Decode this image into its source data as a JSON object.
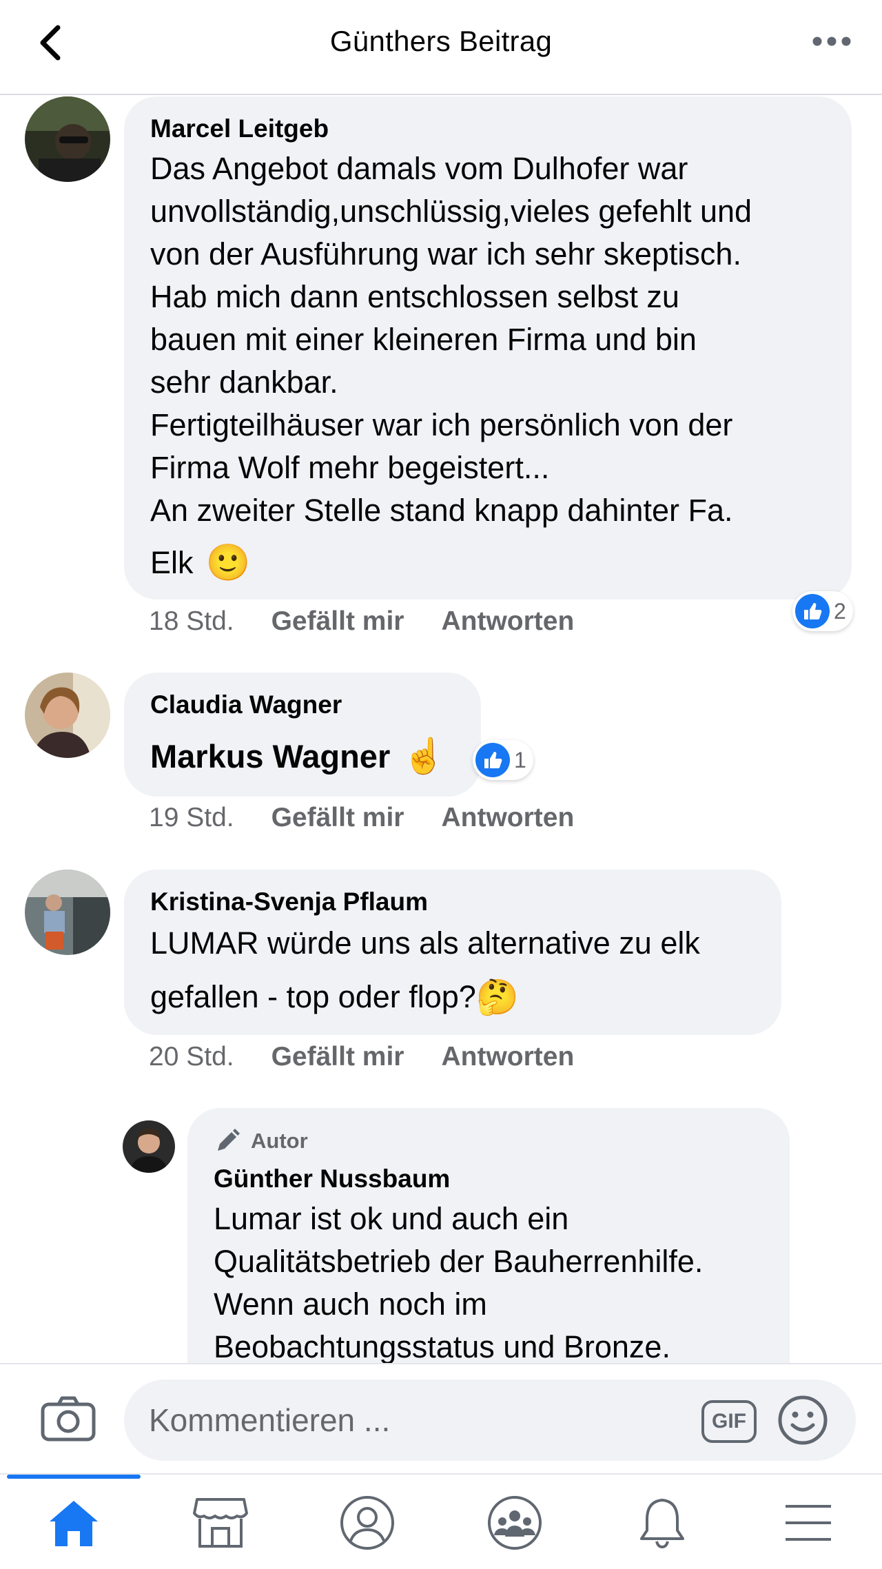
{
  "header": {
    "title": "Günthers Beitrag",
    "back_icon": "chevron-left-icon",
    "more_icon": "ellipsis-icon"
  },
  "comments": [
    {
      "author": "Marcel Leitgeb",
      "text": "Das Angebot damals vom Dulhofer war\nunvollständig,unschlüssig,vieles gefehlt und\nvon der Ausführung war ich sehr skeptisch.\nHab mich dann entschlossen selbst zu\nbauen mit einer kleineren Firma und bin\nsehr dankbar.\nFertigteilhäuser war ich persönlich von der\nFirma Wolf mehr begeistert...\nAn zweiter Stelle stand knapp dahinter Fa.",
      "last_line": "Elk",
      "emoji": "🙂",
      "time": "18 Std.",
      "like_label": "Gefällt mir",
      "reply_label": "Antworten",
      "reaction_count": "2"
    },
    {
      "author": "Claudia Wagner",
      "text": "Markus Wagner",
      "emoji": "☝️",
      "time": "19 Std.",
      "like_label": "Gefällt mir",
      "reply_label": "Antworten",
      "reaction_count": "1"
    },
    {
      "author": "Kristina-Svenja Pflaum",
      "text": "LUMAR würde uns als alternative zu elk",
      "last_line": "gefallen - top oder flop?",
      "emoji": "🤔",
      "time": "20 Std.",
      "like_label": "Gefällt mir",
      "reply_label": "Antworten"
    }
  ],
  "reply": {
    "badge": "Autor",
    "author": "Günther Nussbaum",
    "text": "Lumar ist ok und auch ein\nQualitätsbetrieb der Bauherrenhilfe.\nWenn auch noch im\nBeobachtungsstatus und Bronze."
  },
  "composer": {
    "placeholder": "Kommentieren ...",
    "gif_label": "GIF",
    "camera_icon": "camera-icon",
    "emoji_icon": "smiley-icon"
  },
  "tabs": [
    {
      "icon": "home-icon",
      "active": true
    },
    {
      "icon": "marketplace-icon",
      "active": false
    },
    {
      "icon": "profile-icon",
      "active": false
    },
    {
      "icon": "groups-icon",
      "active": false
    },
    {
      "icon": "bell-icon",
      "active": false
    },
    {
      "icon": "menu-icon",
      "active": false
    }
  ],
  "colors": {
    "accent": "#1877f2",
    "bubble": "#f0f2f5",
    "meta_text": "#65676b",
    "active_tab": "#1877f2",
    "inactive_tab": "#606770"
  }
}
